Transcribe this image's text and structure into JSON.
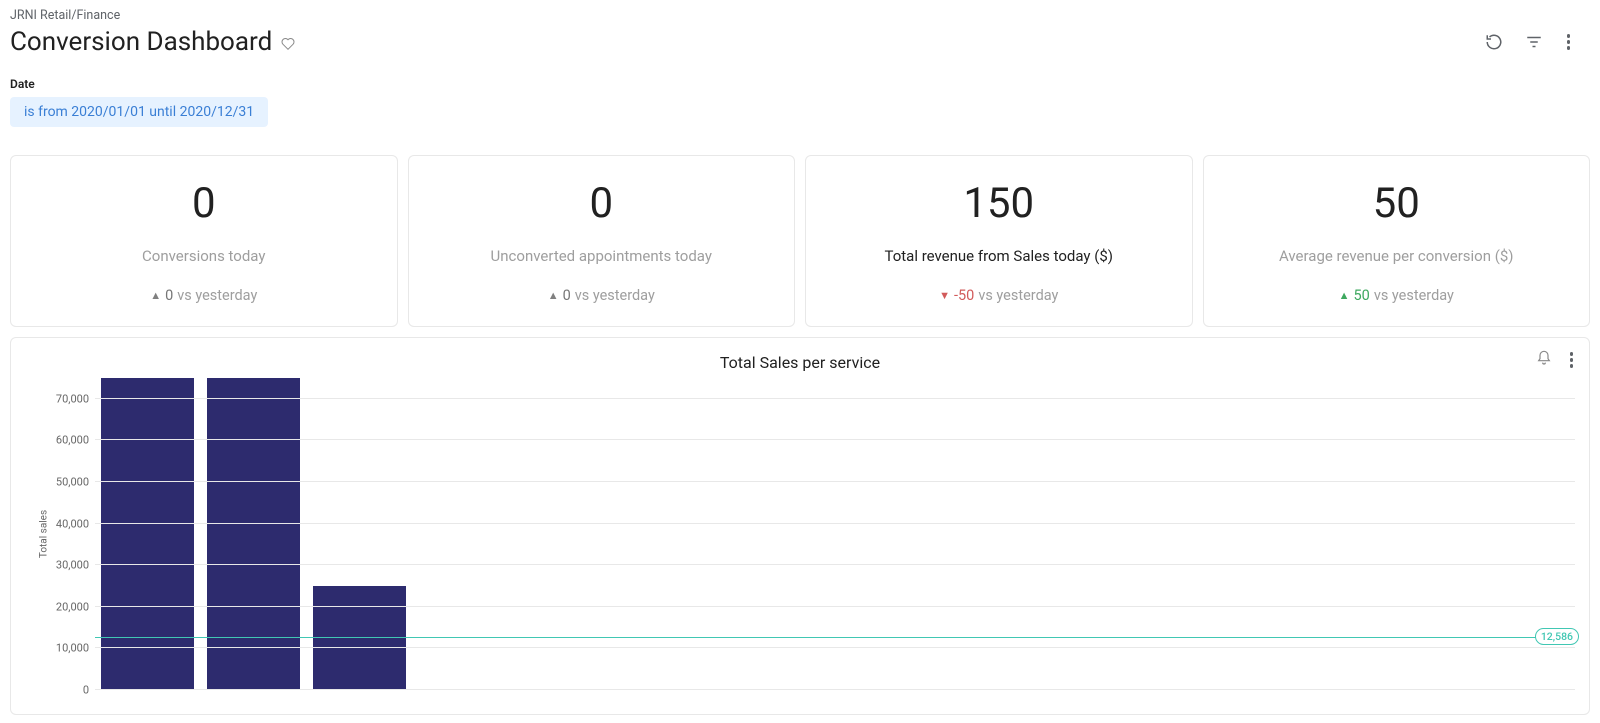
{
  "breadcrumb": "JRNI Retail/Finance",
  "page_title": "Conversion Dashboard",
  "filter": {
    "label": "Date",
    "chip_text": "is from 2020/01/01 until 2020/12/31"
  },
  "cards": [
    {
      "value": "0",
      "label": "Conversions today",
      "delta_dir": "up-grey",
      "delta_value": "0",
      "delta_suffix": " vs yesterday",
      "label_style": "light"
    },
    {
      "value": "0",
      "label": "Unconverted appointments today",
      "delta_dir": "up-grey",
      "delta_value": "0",
      "delta_suffix": " vs yesterday",
      "label_style": "light"
    },
    {
      "value": "150",
      "label": "Total revenue from Sales today ($)",
      "delta_dir": "down-red",
      "delta_value": "-50",
      "delta_suffix": " vs yesterday",
      "label_style": "dark"
    },
    {
      "value": "50",
      "label": "Average revenue per conversion ($)",
      "delta_dir": "up-green",
      "delta_value": "50",
      "delta_suffix": " vs yesterday",
      "label_style": "light"
    }
  ],
  "chart": {
    "title": "Total Sales per service",
    "ylabel": "Total sales",
    "ref_value_label": "12,586"
  },
  "chart_data": {
    "type": "bar",
    "title": "Total Sales per service",
    "xlabel": "",
    "ylabel": "Total sales",
    "ylim": [
      0,
      75000
    ],
    "yticks": [
      0,
      10000,
      20000,
      30000,
      40000,
      50000,
      60000,
      70000
    ],
    "ytick_labels": [
      "0",
      "10,000",
      "20,000",
      "30,000",
      "40,000",
      "50,000",
      "60,000",
      "70,000"
    ],
    "reference_line": 12586,
    "categories": [
      "",
      "",
      "",
      "",
      "",
      "",
      "",
      "",
      "",
      "",
      "",
      "",
      "",
      ""
    ],
    "values": [
      75000,
      75000,
      25000,
      0,
      0,
      0,
      0,
      0,
      0,
      0,
      0,
      0,
      0,
      0
    ]
  }
}
